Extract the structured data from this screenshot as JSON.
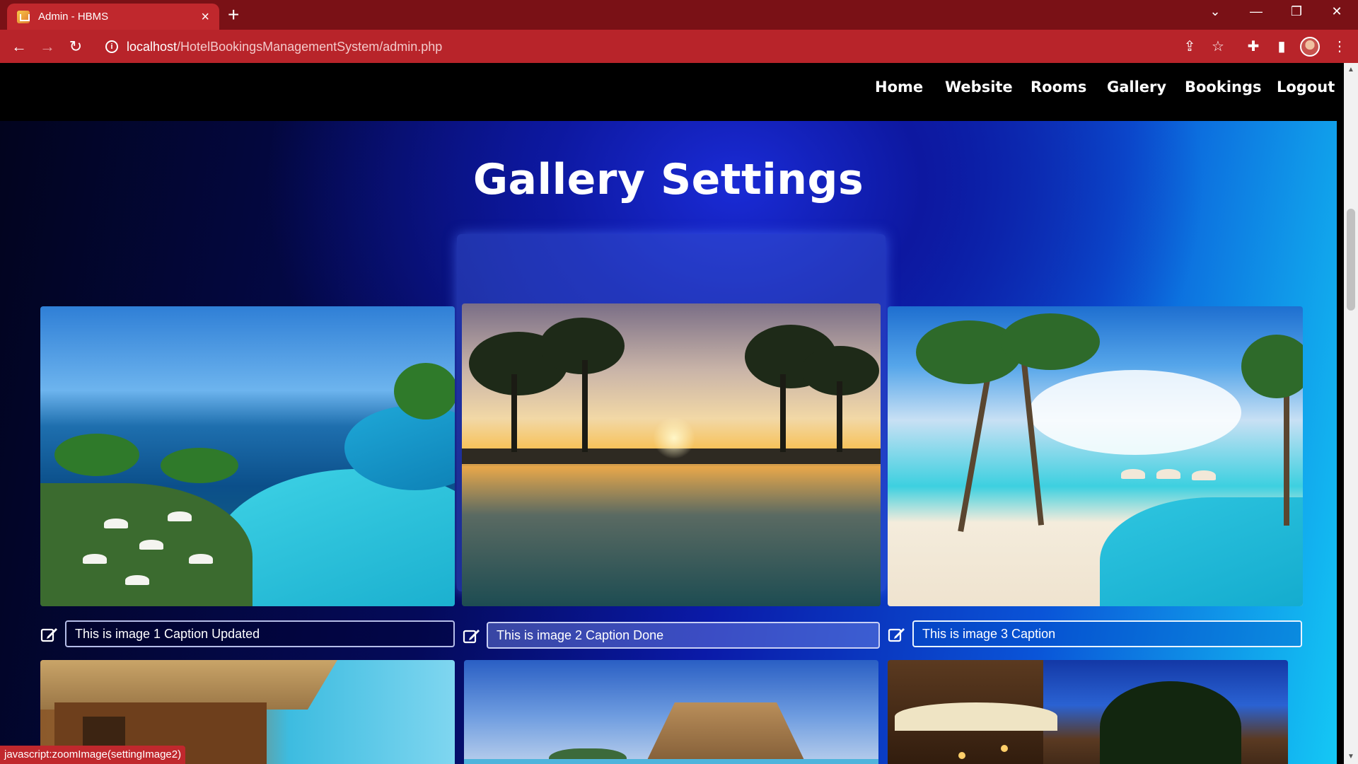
{
  "browser": {
    "tab_title": "Admin - HBMS",
    "url_host": "localhost",
    "url_path": "/HotelBookingsManagementSystem/admin.php",
    "status_text": "javascript:zoomImage(settingImage2)"
  },
  "nav": {
    "items": [
      "Home",
      "Website",
      "Rooms",
      "Gallery",
      "Bookings",
      "Logout"
    ]
  },
  "gallery": {
    "title": "Gallery Settings",
    "captions": [
      "This is image 1 Caption Updated",
      "This is image 2 Caption Done",
      "This is image 3 Caption"
    ]
  },
  "colors": {
    "browser_frame": "#7a1116",
    "browser_toolbar": "#b8242a",
    "nav_bg": "#000000",
    "gallery_gradient_start": "#02041e",
    "gallery_gradient_end": "#14c8f5"
  }
}
